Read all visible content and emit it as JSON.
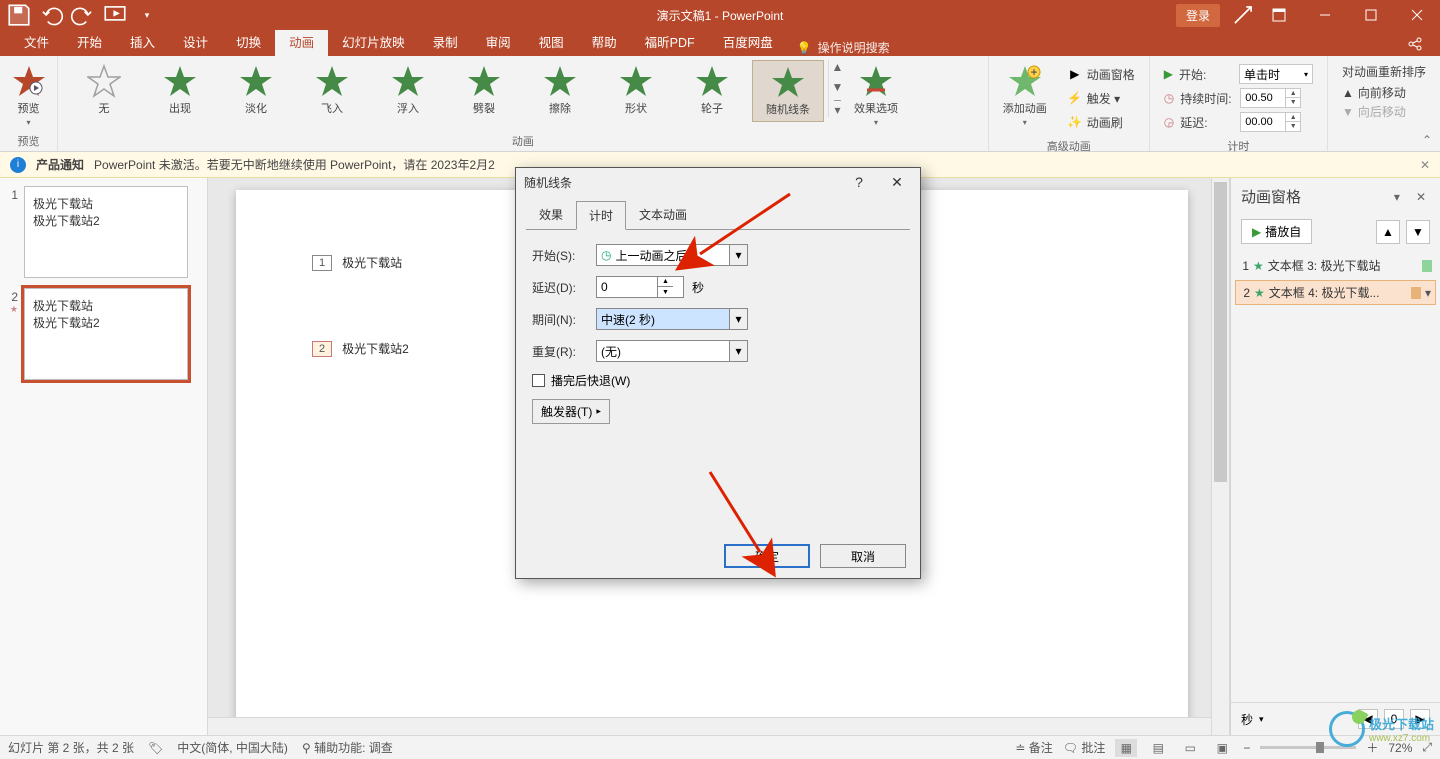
{
  "titlebar": {
    "title": "演示文稿1 - PowerPoint",
    "login": "登录"
  },
  "qat": {
    "save": "save",
    "undo": "undo",
    "redo": "redo",
    "start": "start"
  },
  "tabs": [
    "文件",
    "开始",
    "插入",
    "设计",
    "切换",
    "动画",
    "幻灯片放映",
    "录制",
    "审阅",
    "视图",
    "帮助",
    "福昕PDF",
    "百度网盘"
  ],
  "active_tab": "动画",
  "tell": "操作说明搜索",
  "share": "共享",
  "ribbon": {
    "preview": {
      "label": "预览",
      "group": "预览"
    },
    "effects": [
      "无",
      "出现",
      "淡化",
      "飞入",
      "浮入",
      "劈裂",
      "擦除",
      "形状",
      "轮子",
      "随机线条"
    ],
    "effects_group": "动画",
    "selected_effect": "随机线条",
    "effect_options": "效果选项",
    "adv": {
      "add": "添加动画",
      "pane": "动画窗格",
      "trigger": "触发 ▾",
      "painter": "动画刷",
      "group": "高级动画"
    },
    "timing": {
      "start_lbl": "开始:",
      "start_val": "单击时",
      "duration_lbl": "持续时间:",
      "duration_val": "00.50",
      "delay_lbl": "延迟:",
      "delay_val": "00.00",
      "group": "计时"
    },
    "reorder": {
      "hdr": "对动画重新排序",
      "fwd": "向前移动",
      "back": "向后移动"
    }
  },
  "msgbar": {
    "tag": "产品通知",
    "text": "PowerPoint 未激活。若要无中断地继续使用 PowerPoint，请在 2023年2月2"
  },
  "thumbs": [
    {
      "n": "1",
      "lines": [
        "极光下载站",
        "极光下载站2"
      ]
    },
    {
      "n": "2",
      "lines": [
        "极光下载站",
        "极光下载站2"
      ],
      "sel": true,
      "star": "★"
    }
  ],
  "slide": {
    "t1": {
      "num": "1",
      "text": "极光下载站"
    },
    "t2": {
      "num": "2",
      "text": "极光下载站2"
    }
  },
  "pane": {
    "title": "动画窗格",
    "play": "播放自",
    "items": [
      {
        "idx": "1",
        "name": "文本框 3: 极光下载站"
      },
      {
        "idx": "2",
        "name": "文本框 4: 极光下载...",
        "sel": true
      }
    ],
    "seconds": "秒"
  },
  "dialog": {
    "title": "随机线条",
    "tabs": [
      "效果",
      "计时",
      "文本动画"
    ],
    "active": "计时",
    "start_lbl": "开始(S):",
    "start_val": "上一动画之后",
    "delay_lbl": "延迟(D):",
    "delay_val": "0",
    "delay_unit": "秒",
    "period_lbl": "期间(N):",
    "period_val": "中速(2 秒)",
    "repeat_lbl": "重复(R):",
    "repeat_val": "(无)",
    "rewind": "播完后快退(W)",
    "trigger": "触发器(T)",
    "trigger_caret": "▾",
    "ok": "确定",
    "cancel": "取消"
  },
  "status": {
    "slide": "幻灯片 第 2 张，共 2 张",
    "lang": "中文(简体, 中国大陆)",
    "acc": "辅助功能: 调查",
    "notes": "备注",
    "comments": "批注",
    "zoom": "72%"
  },
  "watermark": {
    "name": "极光下载站",
    "sub": "www.xz7.com"
  }
}
